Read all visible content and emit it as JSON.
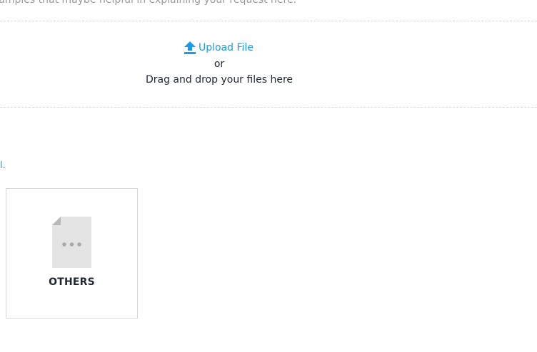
{
  "instructions": {
    "cutoff_text": "xamples that maybe helpful in explaining your request here."
  },
  "dropzone": {
    "upload_label": "Upload File",
    "or_label": "or",
    "drag_label": "Drag and drop your files here",
    "icon": "upload-arrow-icon",
    "accent_color": "#1a9be6"
  },
  "stray_text": "l.",
  "file_types": [
    {
      "label": "OTHERS",
      "icon": "file-dots-icon"
    }
  ]
}
